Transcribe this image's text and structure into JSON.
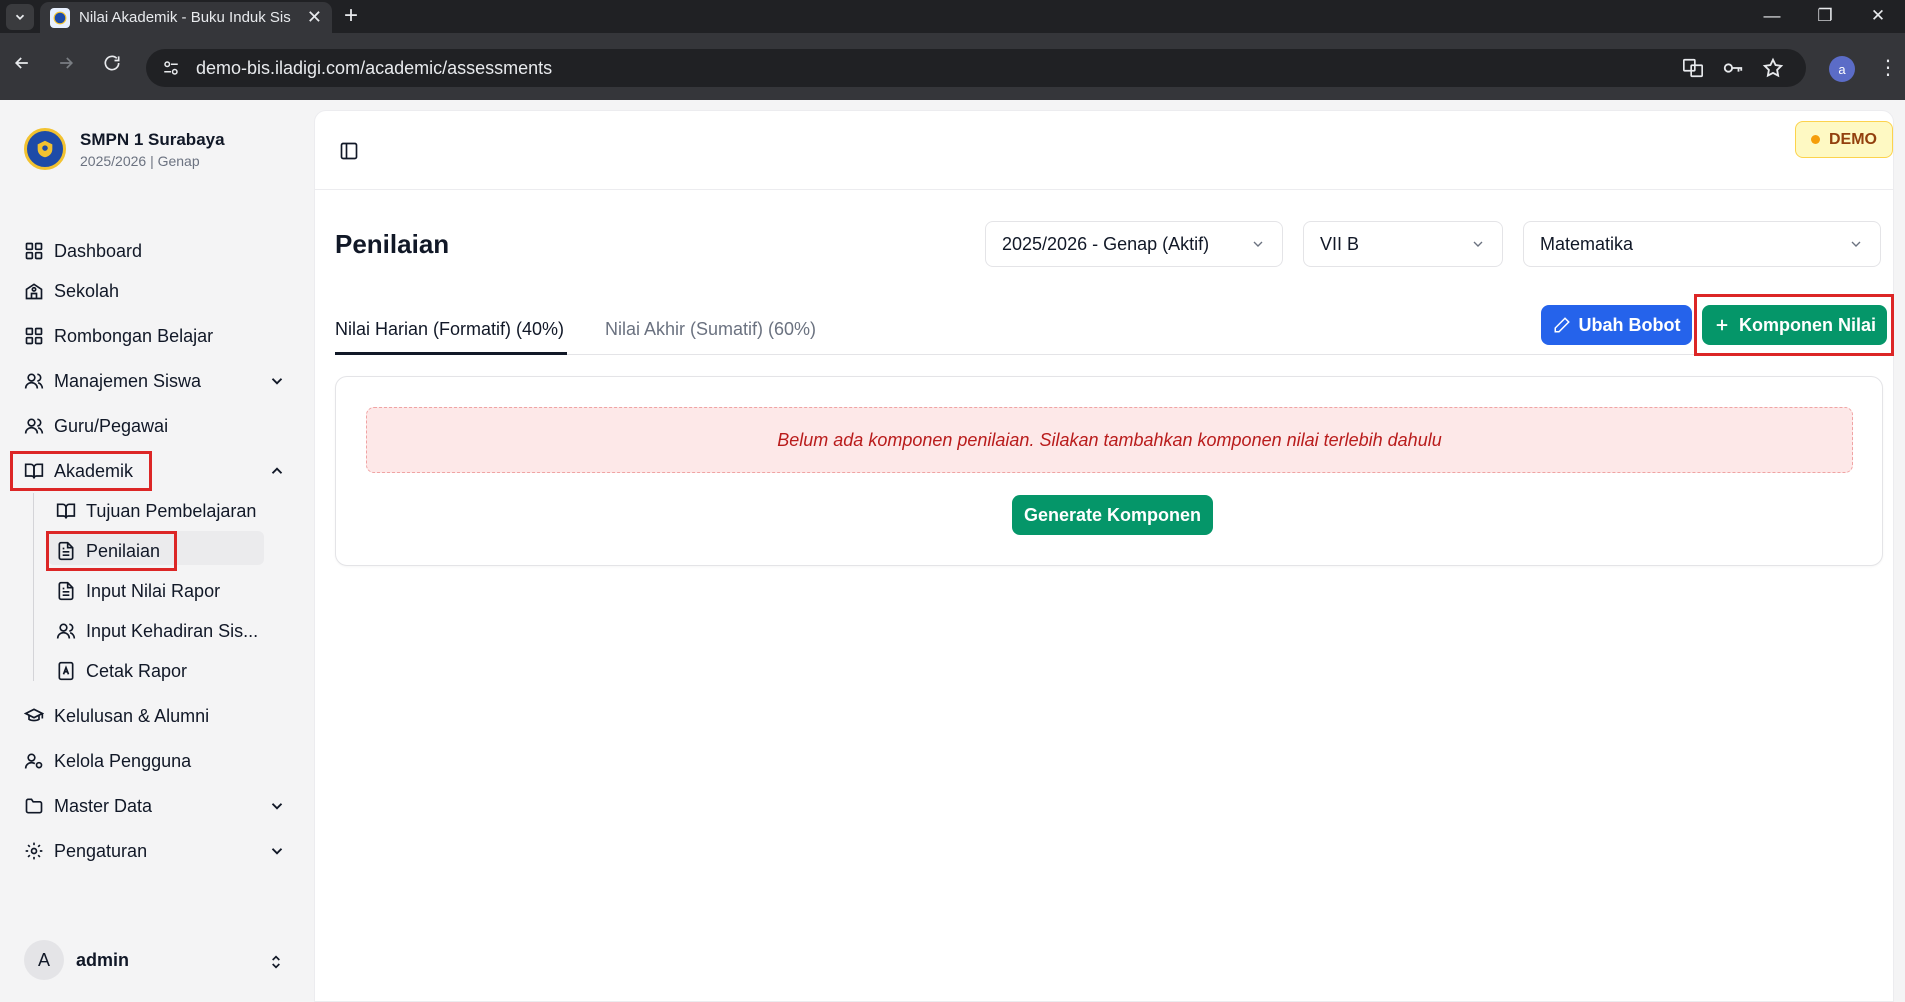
{
  "browser": {
    "tab_title": "Nilai Akademik - Buku Induk Sis",
    "url": "demo-bis.iladigi.com/academic/assessments",
    "profile_initial": "a"
  },
  "school": {
    "name": "SMPN 1 Surabaya",
    "term": "2025/2026 | Genap"
  },
  "sidebar": {
    "items": [
      {
        "label": "Dashboard",
        "icon": "grid-icon"
      },
      {
        "label": "Sekolah",
        "icon": "school-icon"
      },
      {
        "label": "Rombongan Belajar",
        "icon": "grid-icon"
      },
      {
        "label": "Manajemen Siswa",
        "icon": "users-icon",
        "expandable": true
      },
      {
        "label": "Guru/Pegawai",
        "icon": "users-icon"
      },
      {
        "label": "Akademik",
        "icon": "book-open-icon",
        "expanded": true
      },
      {
        "label": "Kelulusan & Alumni",
        "icon": "graduation-cap-icon"
      },
      {
        "label": "Kelola Pengguna",
        "icon": "user-cog-icon"
      },
      {
        "label": "Master Data",
        "icon": "folder-icon",
        "expandable": true
      },
      {
        "label": "Pengaturan",
        "icon": "gear-icon",
        "expandable": true
      }
    ],
    "akademik_sub": [
      {
        "label": "Tujuan Pembelajaran",
        "icon": "book-open-icon"
      },
      {
        "label": "Penilaian",
        "icon": "file-text-icon",
        "active": true
      },
      {
        "label": "Input Nilai Rapor",
        "icon": "file-text-icon"
      },
      {
        "label": "Input Kehadiran Sis...",
        "icon": "users-icon"
      },
      {
        "label": "Cetak Rapor",
        "icon": "report-icon"
      }
    ]
  },
  "user": {
    "initial": "A",
    "name": "admin"
  },
  "header": {
    "badge": "DEMO"
  },
  "page": {
    "title": "Penilaian",
    "filters": {
      "term": "2025/2026 - Genap (Aktif)",
      "class": "VII B",
      "subject": "Matematika"
    },
    "tabs": [
      {
        "label": "Nilai Harian (Formatif) (40%)",
        "active": true
      },
      {
        "label": "Nilai Akhir (Sumatif) (60%)",
        "active": false
      }
    ],
    "actions": {
      "edit_weight": "Ubah Bobot",
      "add_component": "Komponen Nilai"
    },
    "empty_message": "Belum ada komponen penilaian. Silakan tambahkan komponen nilai terlebih dahulu",
    "generate_button": "Generate Komponen"
  },
  "colors": {
    "primary_blue": "#2563eb",
    "primary_green": "#059669",
    "highlight_red": "#dc2626",
    "demo_badge_bg": "#fef9c3"
  }
}
